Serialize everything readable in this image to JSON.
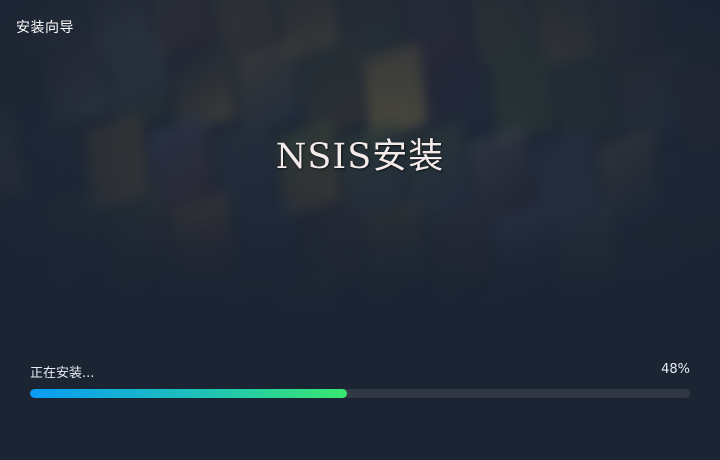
{
  "window": {
    "title": "安装向导"
  },
  "hero": {
    "title": "NSIS安装"
  },
  "progress": {
    "status": "正在安装...",
    "percent_label": "48%",
    "value": 0.48
  },
  "colors": {
    "background": "#1b2433",
    "track": "#323843",
    "fill_start": "#0a9cf5",
    "fill_end": "#39e86f"
  }
}
